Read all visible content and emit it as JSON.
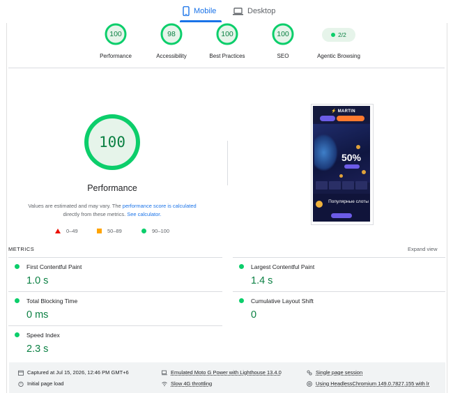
{
  "tabs": [
    {
      "label": "Mobile",
      "icon": "smartphone-icon",
      "active": true
    },
    {
      "label": "Desktop",
      "icon": "laptop-icon",
      "active": false
    }
  ],
  "summary": {
    "gauges": [
      {
        "label": "Performance",
        "score": "100",
        "value": 100
      },
      {
        "label": "Accessibility",
        "score": "98",
        "value": 98
      },
      {
        "label": "Best Practices",
        "score": "100",
        "value": 100
      },
      {
        "label": "SEO",
        "score": "100",
        "value": 100
      }
    ],
    "agentic": {
      "label": "Agentic Browsing",
      "score": "2/2"
    }
  },
  "performance": {
    "score": "100",
    "value": 100,
    "title": "Performance",
    "note_prefix": "Values are estimated and may vary. The ",
    "note_link1": "performance score is calculated",
    "note_middle": " directly from these metrics. ",
    "note_link2": "See calculator.",
    "legend": [
      {
        "range": "0–49",
        "shape": "triangle",
        "color": "#eb0f00"
      },
      {
        "range": "50–89",
        "shape": "square",
        "color": "#ffa400"
      },
      {
        "range": "90–100",
        "shape": "circle",
        "color": "#0cce6b"
      }
    ]
  },
  "screenshot": {
    "brand": "⚡ MARTIN",
    "promo_pct": "50%",
    "slots_title": "Популярные слоты"
  },
  "metrics": {
    "heading": "METRICS",
    "expand": "Expand view",
    "items": [
      {
        "label": "First Contentful Paint",
        "value": "1.0 s"
      },
      {
        "label": "Largest Contentful Paint",
        "value": "1.4 s"
      },
      {
        "label": "Total Blocking Time",
        "value": "0 ms"
      },
      {
        "label": "Cumulative Layout Shift",
        "value": "0"
      },
      {
        "label": "Speed Index",
        "value": "2.3 s"
      }
    ]
  },
  "footer": {
    "captured": "Captured at Jul 15, 2026, 12:46 PM GMT+6",
    "initial": "Initial page load",
    "device": "Emulated Moto G Power with Lighthouse 13.4.0",
    "throttling": "Slow 4G throttling",
    "session": "Single page session",
    "browser": "Using HeadlessChromium 149.0.7827.155 with lr"
  },
  "colors": {
    "pass": "#0cce6b",
    "pass_text": "#0b8043",
    "accent": "#1a73e8"
  }
}
